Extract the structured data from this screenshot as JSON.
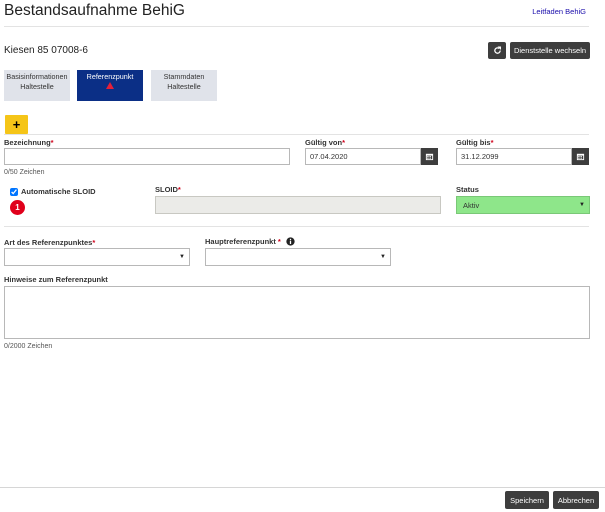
{
  "header": {
    "title": "Bestandsaufnahme BehiG",
    "help_link": "Leitfaden BehiG"
  },
  "stop": {
    "title": "Kiesen 85 07008-6",
    "change_office_label": "Dienststelle wechseln"
  },
  "tabs": [
    {
      "line1": "Basisinformationen",
      "line2": "Haltestelle",
      "active": false
    },
    {
      "line1": "Referenzpunkt",
      "line2": "",
      "active": true,
      "warning": true
    },
    {
      "line1": "Stammdaten",
      "line2": "Haltestelle",
      "active": false
    }
  ],
  "add_button": "+",
  "form": {
    "designation": {
      "label": "Bezeichnung",
      "required_mark": "*",
      "value": "",
      "hint": "0/50 Zeichen"
    },
    "valid_from": {
      "label": "Gültig von",
      "required_mark": "*",
      "value": "07.04.2020"
    },
    "valid_to": {
      "label": "Gültig bis",
      "required_mark": "*",
      "value": "31.12.2099"
    },
    "auto_sloid": {
      "label": "Automatische SLOID",
      "checked": true,
      "badge": "1"
    },
    "sloid": {
      "label": "SLOID",
      "required_mark": "*",
      "value": ""
    },
    "status": {
      "label": "Status",
      "value": "Aktiv",
      "color": "#8ee68a"
    },
    "ref_type": {
      "label": "Art des Referenzpunktes",
      "required_mark": "*",
      "value": ""
    },
    "main_ref": {
      "label": "Hauptreferenzpunkt",
      "required_mark": "*",
      "value": ""
    },
    "notes": {
      "label": "Hinweise zum Referenzpunkt",
      "value": "",
      "hint": "0/2000 Zeichen"
    }
  },
  "footer": {
    "save_label": "Speichern",
    "cancel_label": "Abbrechen"
  },
  "icons": {
    "refresh": "refresh-icon",
    "calendar": "calendar-icon",
    "info": "info-icon",
    "warning": "warning-icon"
  }
}
